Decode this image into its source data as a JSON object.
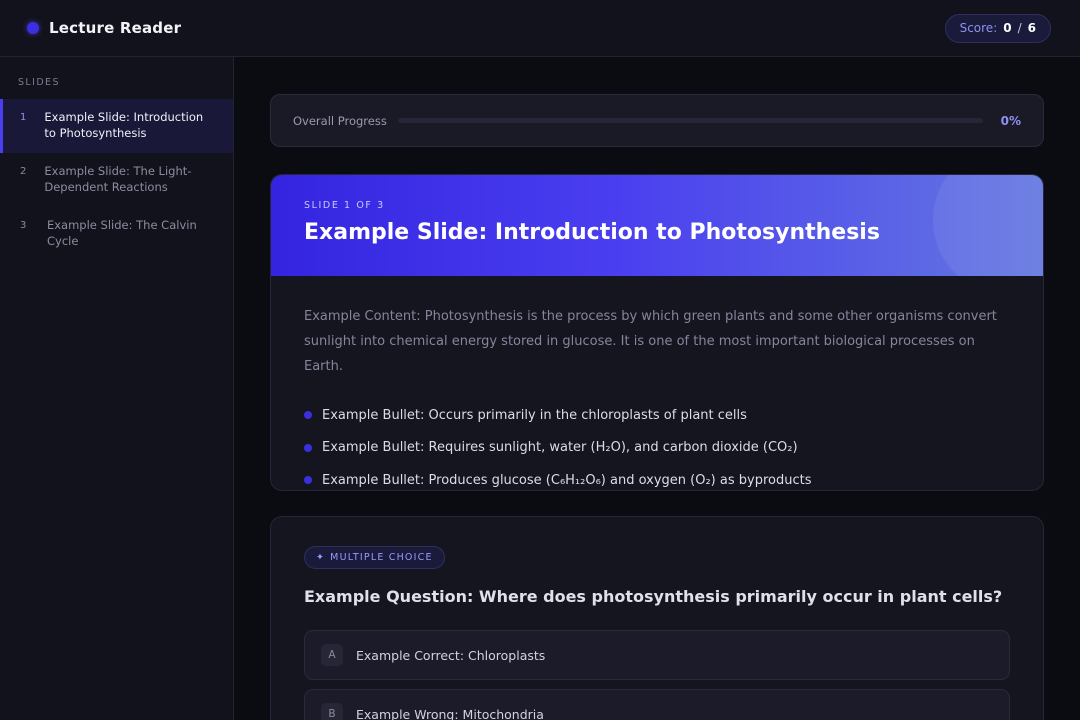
{
  "header": {
    "app_title": "Lecture Reader",
    "score_label": "Score:",
    "score_current": "0",
    "score_separator": "/",
    "score_total": "6"
  },
  "sidebar": {
    "heading": "SLIDES",
    "items": [
      {
        "number": "1",
        "label": "Example Slide: Introduction to Photosynthesis",
        "active": true
      },
      {
        "number": "2",
        "label": "Example Slide: The Light-Dependent Reactions",
        "active": false
      },
      {
        "number": "3",
        "label": "Example Slide: The Calvin Cycle",
        "active": false
      }
    ]
  },
  "progress": {
    "label": "Overall Progress",
    "percent_text": "0%",
    "value": 0
  },
  "slide": {
    "kicker": "SLIDE 1 OF 3",
    "title": "Example Slide: Introduction to Photosynthesis",
    "intro": "Example Content: Photosynthesis is the process by which green plants and some other organisms convert sunlight into chemical energy stored in glucose. It is one of the most important biological processes on Earth.",
    "bullets": [
      "Example Bullet: Occurs primarily in the chloroplasts of plant cells",
      "Example Bullet: Requires sunlight, water (H₂O), and carbon dioxide (CO₂)",
      "Example Bullet: Produces glucose (C₆H₁₂O₆) and oxygen (O₂) as byproducts"
    ]
  },
  "question": {
    "badge_icon": "✦",
    "badge_label": "MULTIPLE CHOICE",
    "text": "Example Question: Where does photosynthesis primarily occur in plant cells?",
    "options": [
      {
        "letter": "A",
        "text": "Example Correct: Chloroplasts"
      },
      {
        "letter": "B",
        "text": "Example Wrong: Mitochondria"
      }
    ]
  },
  "colors": {
    "accent": "#4a3ff0",
    "background": "#0b0b12",
    "panel": "#12121c"
  }
}
